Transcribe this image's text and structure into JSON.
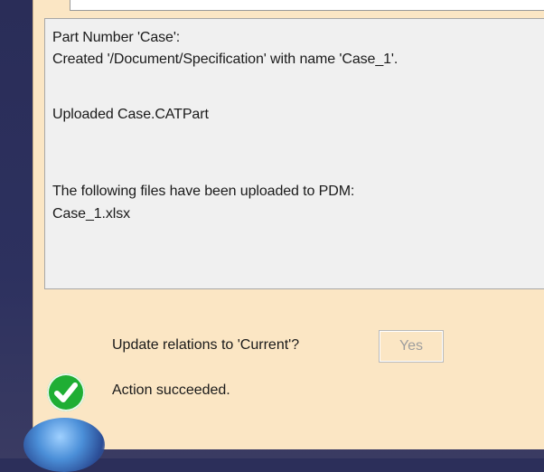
{
  "log": {
    "lines": [
      "Part Number 'Case':",
      "Created '/Document/Specification' with name 'Case_1'.",
      "Uploaded Case.CATPart",
      "The following files have been uploaded to PDM:",
      "Case_1.xlsx"
    ]
  },
  "update": {
    "label": "Update relations to 'Current'?",
    "button_label": "Yes"
  },
  "status": {
    "text": "Action succeeded.",
    "icon": "success-check-icon"
  },
  "colors": {
    "dialog_bg": "#fbe6c4",
    "log_bg": "#f0f0f0",
    "success_green": "#1fae34"
  }
}
